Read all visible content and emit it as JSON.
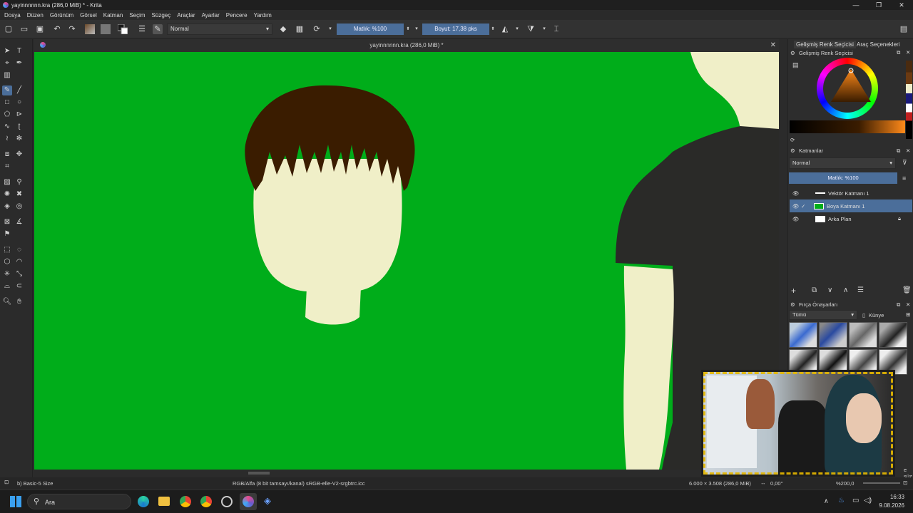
{
  "window": {
    "title": "yayinnnnnn.kra (286,0 MiB) * - Krita",
    "controls": [
      "—",
      "❐",
      "✕"
    ]
  },
  "menu": [
    "Dosya",
    "Düzen",
    "Görünüm",
    "Görsel",
    "Katman",
    "Seçim",
    "Süzgeç",
    "Araçlar",
    "Ayarlar",
    "Pencere",
    "Yardım"
  ],
  "toolbar": {
    "blend_mode": "Normal",
    "opacity_label": "Matlık: %100",
    "size_label": "Boyut: 17,38 pks"
  },
  "document": {
    "tab_title": "yayinnnnnn.kra (286,0 MiB) *",
    "close_icon": "✕"
  },
  "right_tabs": {
    "color_selector": "Gelişmiş Renk Seçicisi",
    "tool_options": "Araç Seçenekleri"
  },
  "color_panel": {
    "title": "Gelişmiş Renk Seçicisi"
  },
  "layers_panel": {
    "title": "Katmanlar",
    "blend_mode": "Normal",
    "opacity_label": "Matlık: %100",
    "layers": [
      {
        "name": "Vektör Katmanı 1"
      },
      {
        "name": "Boya Katmanı 1"
      },
      {
        "name": "Arka Plan"
      }
    ]
  },
  "brush_panel": {
    "title": "Fırça Önayarları",
    "filter": "Tümü",
    "tag_label": "Künye"
  },
  "status": {
    "brush_name": "b) Basic-5 Size",
    "color_profile": "RGB/Alfa (8 bit tamsayı/kanal) sRGB-elle-V2-srgbtrc.icc",
    "dimensions": "6.000 × 3.508 (286,0 MiB)",
    "rotation": "0,00°",
    "zoom": "%200,0",
    "filter_hint": "e süz"
  },
  "taskbar": {
    "search_label": "Ara",
    "time": "16:33",
    "date": "9.08.2026"
  },
  "colors": {
    "canvas_green": "#00ad1a",
    "skin": "#f0efc8",
    "hair": "#3a1c00",
    "shirt": "#2a2a28",
    "accent": "#4b6e9a"
  }
}
